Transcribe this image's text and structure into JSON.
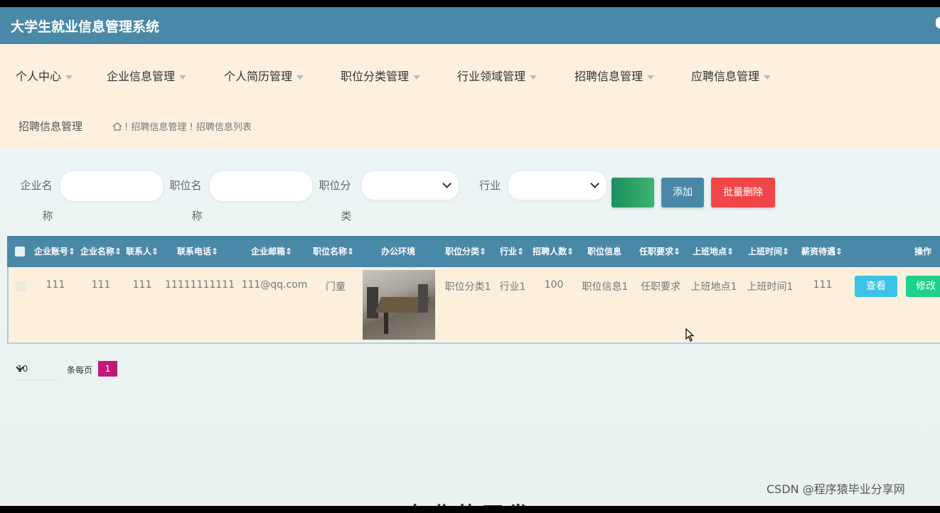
{
  "app": {
    "title": "大学生就业信息管理系统"
  },
  "menu": {
    "items": [
      "个人中心",
      "企业信息管理",
      "个人简历管理",
      "职位分类管理",
      "行业领域管理",
      "招聘信息管理",
      "应聘信息管理"
    ]
  },
  "breadcrumb": {
    "section": "招聘信息管理",
    "path": "! 招聘信息管理 ! 招聘信息列表"
  },
  "search": {
    "company_label_1": "企业名",
    "company_label_2": "称",
    "job_label_1": "职位名",
    "job_label_2": "称",
    "category_label_1": "职位分",
    "category_label_2": "类",
    "industry_label": "行业",
    "company_value": "",
    "job_value": "",
    "category_selected": "",
    "industry_selected": "",
    "search_button": "",
    "add_button": "添加",
    "batch_delete_button": "批量删除"
  },
  "table": {
    "headers": [
      "企业账号",
      "企业名称",
      "联系人",
      "联系电话",
      "企业邮箱",
      "职位名称",
      "办公环境",
      "职位分类",
      "行业",
      "招聘人数",
      "职位信息",
      "任职要求",
      "上班地点",
      "上班时间",
      "薪资待遇",
      "操作"
    ],
    "rows": [
      {
        "account": "111",
        "company": "111",
        "contact": "111",
        "phone": "11111111111",
        "email": "111@qq.com",
        "job": "门童",
        "category": "职位分类1",
        "industry": "行业1",
        "count": "100",
        "info": "职位信息1",
        "requirement": "任职要求",
        "location": "上班地点1",
        "time": "上班时间1",
        "salary": "111",
        "view_button": "查看",
        "edit_button": "修改"
      }
    ]
  },
  "pager": {
    "page_size": "10",
    "per_page_label": "条每页",
    "current_page": "1"
  },
  "watermark": "CSDN @程序猿毕业分享网",
  "bottom_text": "专业的开发"
}
